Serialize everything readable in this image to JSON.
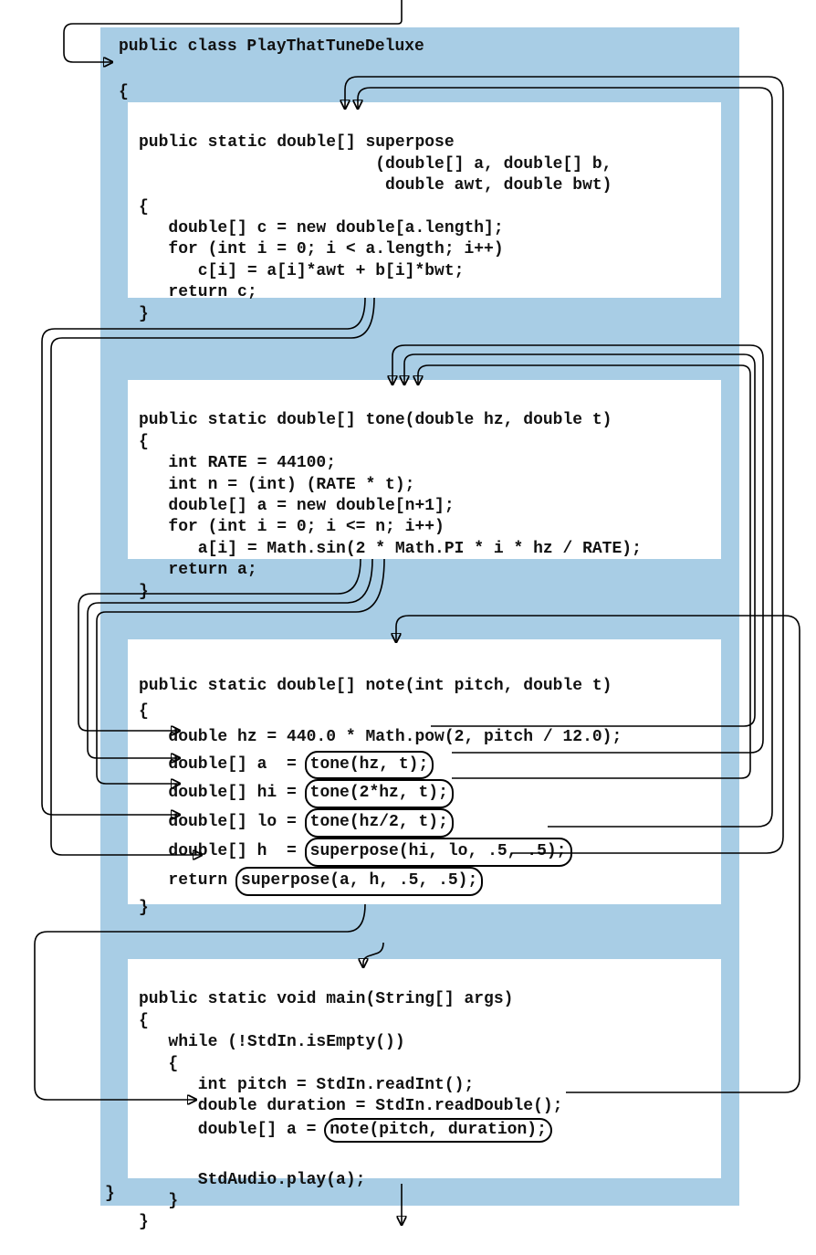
{
  "classDecl": "public class PlayThatTuneDeluxe",
  "openBrace": "{",
  "closeBrace": "}",
  "superpose": {
    "sig1": "public static double[] superpose",
    "sig2": "                        (double[] a, double[] b,",
    "sig3": "                         double awt, double bwt)",
    "open": "{",
    "l1": "   double[] c = new double[a.length];",
    "l2": "   for (int i = 0; i < a.length; i++)",
    "l3": "      c[i] = a[i]*awt + b[i]*bwt;",
    "l4": "   return c;",
    "close": "}"
  },
  "tone": {
    "sig": "public static double[] tone(double hz, double t)",
    "open": "{",
    "l1": "   int RATE = 44100;",
    "l2": "   int n = (int) (RATE * t);",
    "l3": "   double[] a = new double[n+1];",
    "l4": "   for (int i = 0; i <= n; i++)",
    "l5": "      a[i] = Math.sin(2 * Math.PI * i * hz / RATE);",
    "l6": "   return a;",
    "close": "}"
  },
  "note": {
    "sig": "public static double[] note(int pitch, double t)",
    "open": "{",
    "l1": "   double hz = 440.0 * Math.pow(2, pitch / 12.0);",
    "l2a": "   double[] a  = ",
    "l2b": "tone(hz, t);",
    "l3a": "   double[] hi = ",
    "l3b": "tone(2*hz, t);",
    "l4a": "   double[] lo = ",
    "l4b": "tone(hz/2, t);",
    "l5a": "   double[] h  = ",
    "l5b": "superpose(hi, lo, .5, .5);",
    "l6a": "   return ",
    "l6b": "superpose(a, h, .5, .5);",
    "close": "}"
  },
  "main": {
    "sig": "public static void main(String[] args)",
    "open": "{",
    "l1": "   while (!StdIn.isEmpty())",
    "l2": "   {",
    "l3": "      int pitch = StdIn.readInt();",
    "l4": "      double duration = StdIn.readDouble();",
    "l5a": "      double[] a = ",
    "l5b": "note(pitch, duration);",
    "l6": "      StdAudio.play(a);",
    "l7": "   }",
    "close": "}"
  }
}
